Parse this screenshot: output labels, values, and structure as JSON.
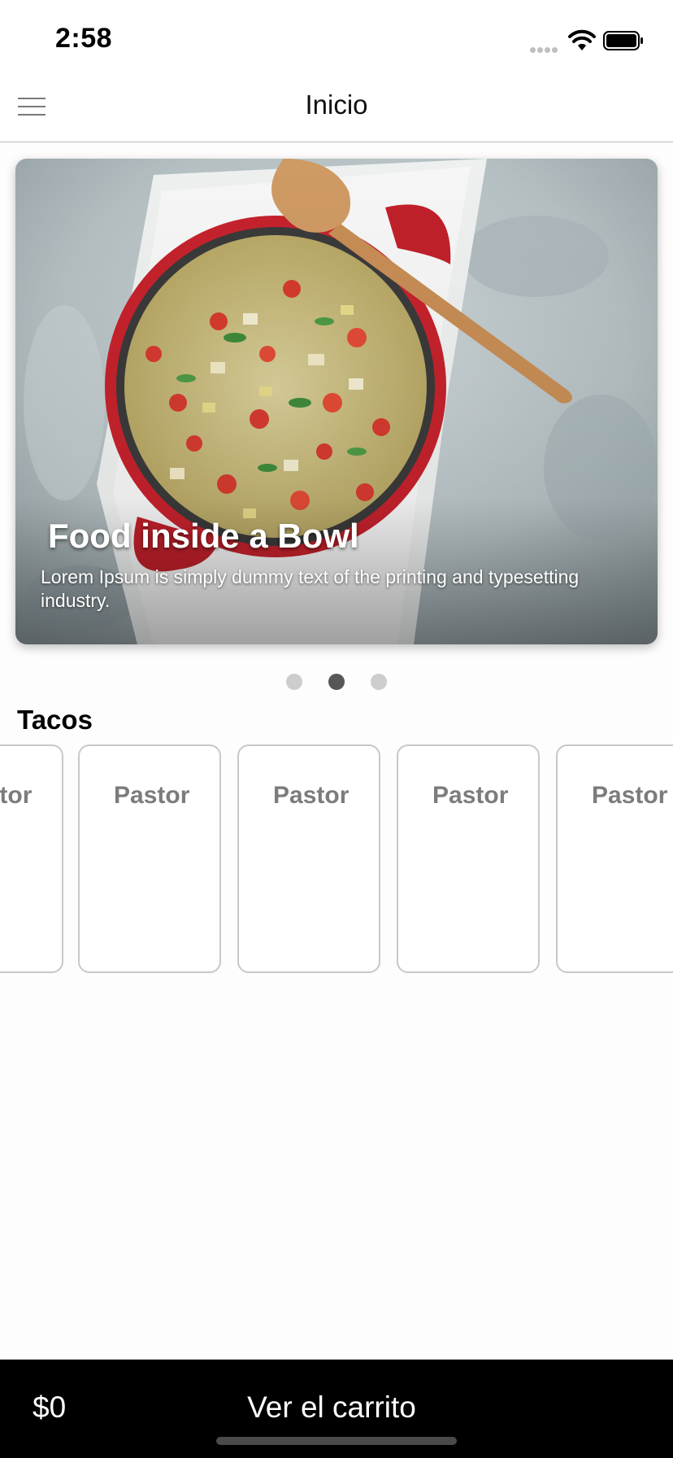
{
  "status_bar": {
    "time": "2:58",
    "icons": [
      "signal-icon",
      "wifi-icon",
      "battery-icon"
    ]
  },
  "nav": {
    "title": "Inicio",
    "menu_icon": "hamburger-menu-icon"
  },
  "carousel": {
    "slides_count": 3,
    "active_index": 1,
    "current_slide": {
      "title": "Food inside a Bowl",
      "description": "Lorem Ipsum is simply dummy text of the printing and typesetting industry.",
      "image": "food-bowl-image"
    }
  },
  "section": {
    "title": "Tacos",
    "cards": [
      {
        "label": "Pastor"
      },
      {
        "label": "Pastor"
      },
      {
        "label": "Pastor"
      },
      {
        "label": "Pastor"
      },
      {
        "label": "Pastor"
      }
    ]
  },
  "cart_bar": {
    "total": "$0",
    "label": "Ver el carrito"
  },
  "colors": {
    "background": "#fefdfd",
    "bottom_bar": "#000000",
    "card_border": "#c8c8c8",
    "card_text": "#7c7c7c",
    "dot_active": "#575757",
    "dot_inactive": "#cdcdcd"
  }
}
